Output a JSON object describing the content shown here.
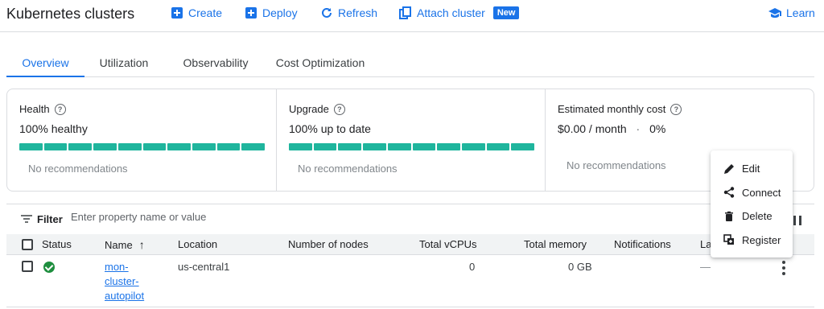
{
  "header": {
    "title": "Kubernetes clusters",
    "actions": [
      {
        "label": "Create",
        "icon": "add-box-icon"
      },
      {
        "label": "Deploy",
        "icon": "add-box-icon"
      },
      {
        "label": "Refresh",
        "icon": "refresh-icon"
      },
      {
        "label": "Attach cluster",
        "icon": "attach-icon",
        "badge": "New"
      }
    ],
    "learn": {
      "label": "Learn",
      "icon": "school-icon"
    }
  },
  "tabs": [
    {
      "label": "Overview",
      "active": true
    },
    {
      "label": "Utilization",
      "active": false
    },
    {
      "label": "Observability",
      "active": false
    },
    {
      "label": "Cost Optimization",
      "active": false
    }
  ],
  "summary": {
    "health": {
      "title": "Health",
      "value": "100% healthy",
      "note": "No recommendations",
      "fill_fraction": 1.0
    },
    "upgrade": {
      "title": "Upgrade",
      "value": "100% up to date",
      "note": "No recommendations",
      "fill_fraction": 1.0
    },
    "cost": {
      "title": "Estimated monthly cost",
      "amount": "$0.00 / month",
      "separator": "·",
      "percent": "0%",
      "note": "No recommendations"
    }
  },
  "filter": {
    "label": "Filter",
    "placeholder": "Enter property name or value"
  },
  "table": {
    "columns": [
      "Status",
      "Name",
      "Location",
      "Number of nodes",
      "Total vCPUs",
      "Total memory",
      "Notifications",
      "La"
    ],
    "sort_indicator": "↑",
    "rows": [
      {
        "status": "ok",
        "name_lines": [
          "mon-",
          "cluster-",
          "autopilot"
        ],
        "location": "us-central1",
        "nodes": "",
        "vcpus": "0",
        "memory": "0 GB",
        "notifications": "",
        "labels": "—"
      }
    ]
  },
  "context_menu": {
    "items": [
      {
        "label": "Edit",
        "icon": "edit-icon"
      },
      {
        "label": "Connect",
        "icon": "connect-icon"
      },
      {
        "label": "Delete",
        "icon": "delete-icon"
      },
      {
        "label": "Register",
        "icon": "register-icon"
      }
    ]
  },
  "colors": {
    "accent": "#1a73e8",
    "healthy": "#1fb59d",
    "status_ok": "#1e8e3e"
  }
}
